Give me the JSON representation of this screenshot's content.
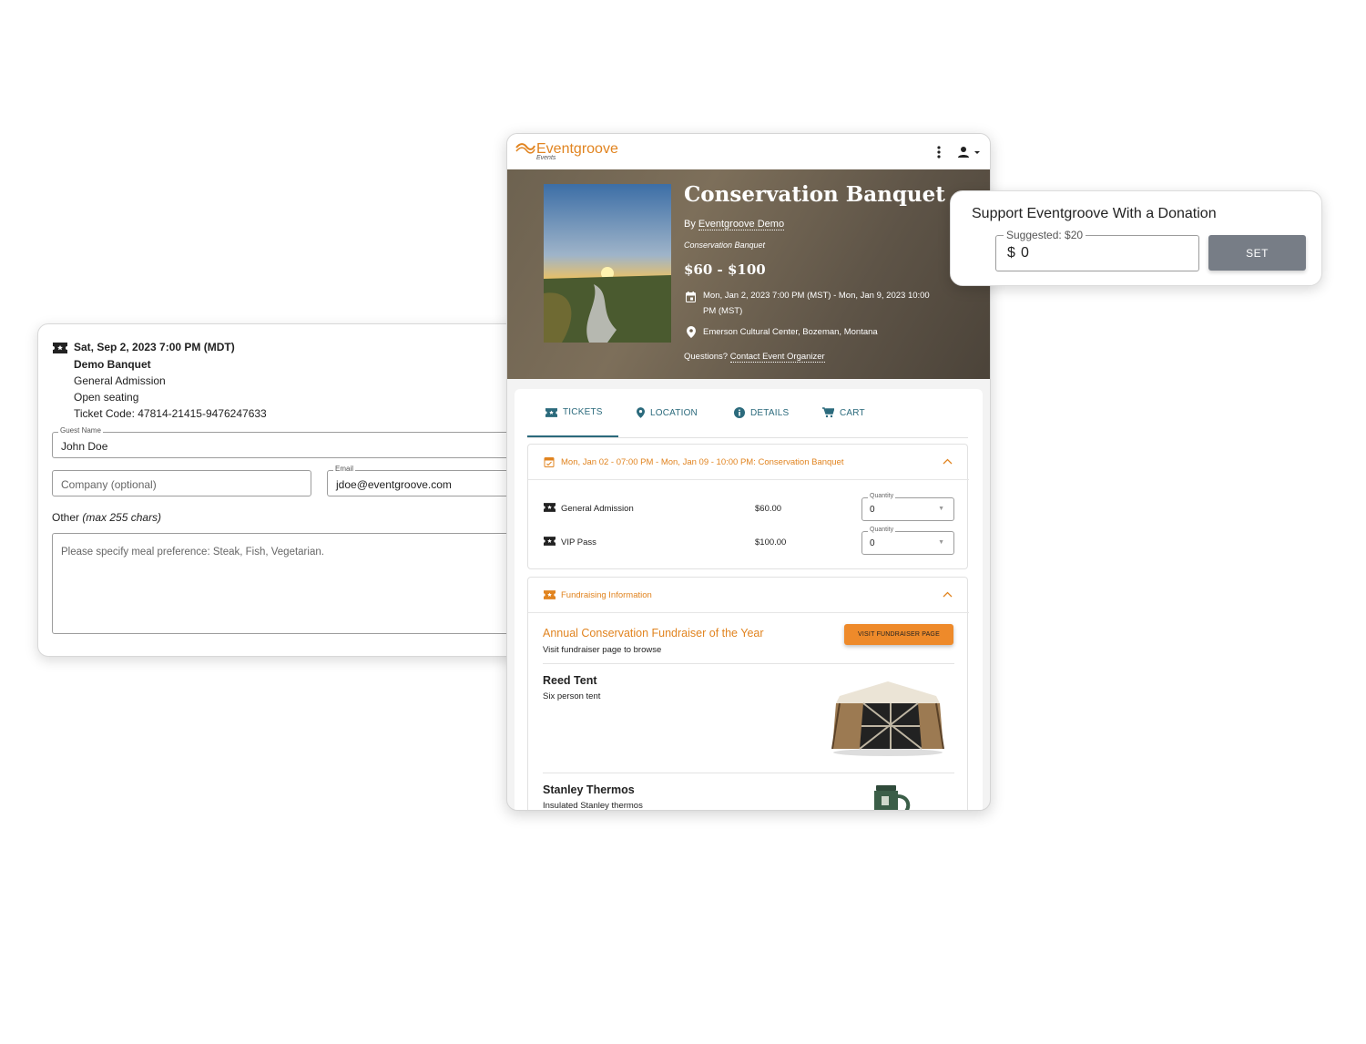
{
  "attendee": {
    "date": "Sat, Sep 2, 2023 7:00 PM (MDT)",
    "event": "Demo Banquet",
    "ticket_type": "General Admission",
    "seating": "Open seating",
    "ticket_code": "Ticket Code: 47814-21415-9476247633",
    "guest_name_label": "Guest Name",
    "guest_name_value": "John Doe",
    "company_placeholder": "Company (optional)",
    "email_label": "Email",
    "email_value": "jdoe@eventgroove.com",
    "other_label": "Other",
    "other_hint": "(max 255 chars)",
    "other_placeholder": "Please specify meal preference: Steak, Fish, Vegetarian."
  },
  "app": {
    "brand": "Eventgroove",
    "brand_sub": "Events",
    "brand_color": "#e18420",
    "menu_icon": "more-vertical-icon",
    "account_icon": "account-icon"
  },
  "event": {
    "title": "Conservation Banquet",
    "by_prefix": "By",
    "organizer": "Eventgroove Demo",
    "subtitle": "Conservation Banquet",
    "price_range": "$60 - $100",
    "dates_line1": "Mon, Jan 2, 2023 7:00 PM (MST) - Mon, Jan 9, 2023 10:00",
    "dates_line2": "PM (MST)",
    "venue": "Emerson Cultural Center, Bozeman, Montana",
    "questions_prefix": "Questions?",
    "contact_link": "Contact Event Organizer"
  },
  "tabs": [
    {
      "label": "TICKETS",
      "icon": "ticket-icon"
    },
    {
      "label": "LOCATION",
      "icon": "location-pin-icon"
    },
    {
      "label": "DETAILS",
      "icon": "info-icon"
    },
    {
      "label": "CART",
      "icon": "cart-icon"
    }
  ],
  "tickets_section": {
    "header": "Mon, Jan 02 - 07:00 PM - Mon, Jan 09 - 10:00 PM: Conservation Banquet",
    "items": [
      {
        "name": "General Admission",
        "price": "$60.00",
        "qty_label": "Quantity",
        "qty": "0"
      },
      {
        "name": "VIP Pass",
        "price": "$100.00",
        "qty_label": "Quantity",
        "qty": "0"
      }
    ]
  },
  "fundraising": {
    "header": "Fundraising Information",
    "title": "Annual Conservation Fundraiser of the Year",
    "subtitle": "Visit fundraiser page to browse",
    "button": "VISIT FUNDRAISER PAGE",
    "items": [
      {
        "name": "Reed Tent",
        "desc": "Six person tent"
      },
      {
        "name": "Stanley Thermos",
        "desc": "Insulated Stanley thermos"
      }
    ]
  },
  "donation": {
    "title": "Support Eventgroove With a Donation",
    "suggested_label": "Suggested: $20",
    "currency": "$",
    "amount": "0",
    "button": "SET"
  }
}
